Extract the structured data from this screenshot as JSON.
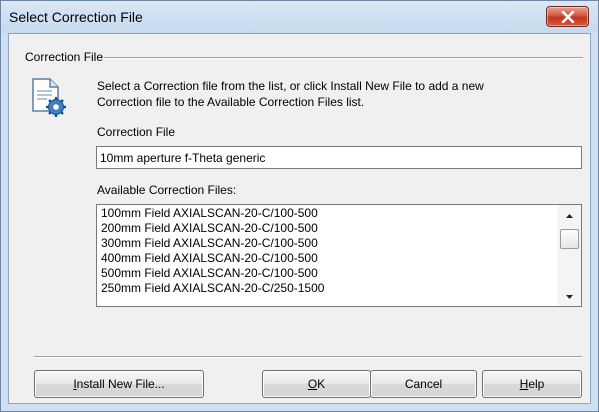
{
  "window": {
    "title": "Select Correction File",
    "close_icon": "close-x-icon"
  },
  "group": {
    "legend": "Correction File",
    "icon": "settings-document-icon",
    "description": [
      "Select a Correction file from the list, or click Install New File to add a new",
      "Correction file to the Available Correction Files list."
    ]
  },
  "correction_file": {
    "label": "Correction File",
    "value": "10mm aperture f-Theta generic"
  },
  "available": {
    "label": "Available Correction Files:",
    "items": [
      "100mm Field AXIALSCAN-20-C/100-500",
      "200mm Field AXIALSCAN-20-C/100-500",
      "300mm Field AXIALSCAN-20-C/100-500",
      "400mm Field AXIALSCAN-20-C/100-500",
      "500mm Field AXIALSCAN-20-C/100-500",
      "250mm Field AXIALSCAN-20-C/250-1500"
    ]
  },
  "buttons": {
    "install": {
      "mnemonic": "I",
      "rest": "nstall New File..."
    },
    "ok": {
      "mnemonic": "O",
      "rest": "K"
    },
    "cancel": {
      "label": "Cancel"
    },
    "help": {
      "mnemonic": "H",
      "rest": "elp"
    }
  },
  "colors": {
    "frame": "#cfe0f2",
    "client": "#f0f0f0",
    "close_button": "#c73b1f"
  }
}
